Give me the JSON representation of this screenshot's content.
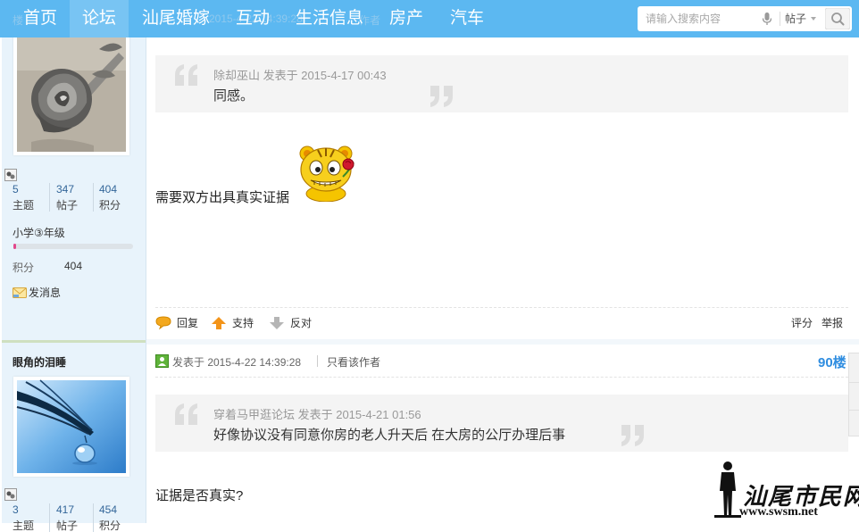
{
  "nav": {
    "items": [
      {
        "label": "首页",
        "active": false
      },
      {
        "label": "论坛",
        "active": true
      },
      {
        "label": "汕尾婚嫁",
        "active": false
      },
      {
        "label": "互动",
        "active": false
      },
      {
        "label": "生活信息",
        "active": false
      },
      {
        "label": "房产",
        "active": false
      },
      {
        "label": "汽车",
        "active": false
      }
    ],
    "search_placeholder": "请输入搜索内容",
    "search_type": "帖子",
    "ghost_meta": [
      "楼",
      "2015-4-22 14:39:28",
      "作者"
    ]
  },
  "sidebar": {
    "user1": {
      "stats": [
        {
          "num": "5",
          "label": "主题"
        },
        {
          "num": "347",
          "label": "帖子"
        },
        {
          "num": "404",
          "label": "积分"
        }
      ],
      "level": "小学③年级",
      "level_progress": 0.02,
      "points_label": "积分",
      "points_value": "404",
      "message_label": "发消息"
    },
    "user2": {
      "name": "眼角的泪睡",
      "stats": [
        {
          "num": "3",
          "label": "主题"
        },
        {
          "num": "417",
          "label": "帖子"
        },
        {
          "num": "454",
          "label": "积分"
        }
      ]
    }
  },
  "post1": {
    "quote_author": "除却巫山 发表于 2015-4-17 00:43",
    "quote_text": "同感。",
    "text": "需要双方出具真实证据",
    "emoji": "tiger-rose-emoji",
    "actions": {
      "reply": "回复",
      "support": "支持",
      "oppose": "反对",
      "rate": "评分",
      "report": "举报"
    }
  },
  "post2": {
    "posted": "发表于 2015-4-22 14:39:28",
    "only_author": "只看该作者",
    "floor": "90楼",
    "quote_author": "穿着马甲逛论坛 发表于 2015-4-21 01:56",
    "quote_text": "好像协议没有同意你房的老人升天后 在大房的公厅办理后事",
    "text": "证据是否真实?"
  },
  "watermark": {
    "title": "汕尾市民网",
    "url": "www.swsm.net"
  },
  "colors": {
    "nav_bg": "#5cb8f1",
    "nav_active": "#78c4f3",
    "sidebar_bg": "#e8f3fb",
    "floor_color": "#2f8de0",
    "level_bar": "#e2478c"
  }
}
